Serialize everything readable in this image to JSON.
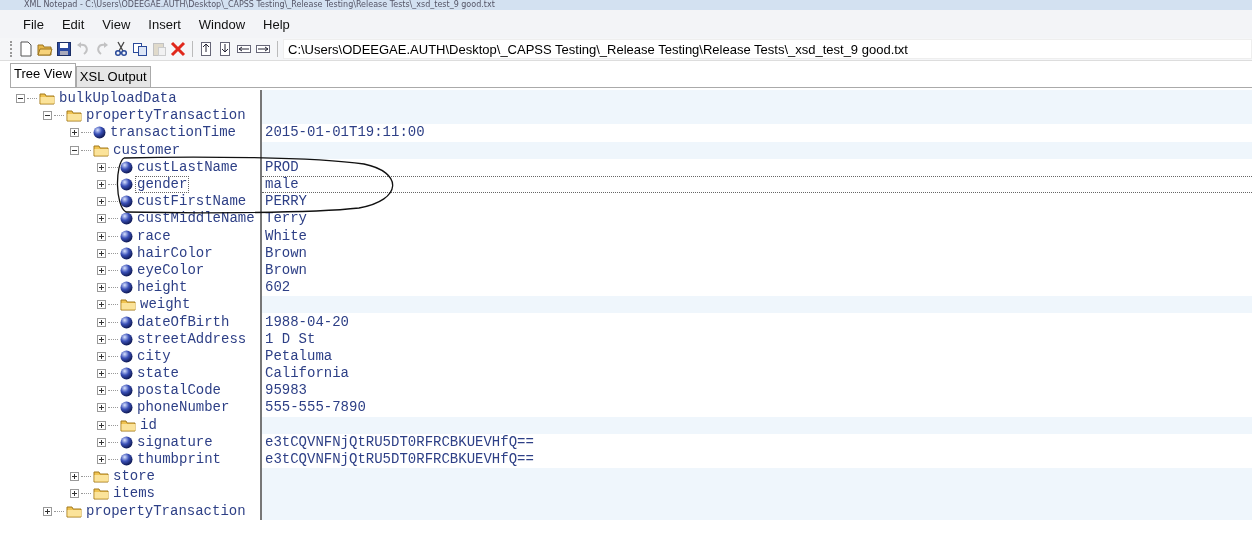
{
  "window": {
    "title": "XML Notepad - C:\\Users\\ODEEGAE.AUTH\\Desktop\\_CAPSS Testing\\_Release Testing\\Release Tests\\_xsd_test_9 good.txt"
  },
  "menu": [
    "File",
    "Edit",
    "View",
    "Insert",
    "Window",
    "Help"
  ],
  "toolbar": {
    "buttons": [
      {
        "kind": "new",
        "disabled": false
      },
      {
        "kind": "open",
        "disabled": false
      },
      {
        "kind": "save",
        "disabled": false
      },
      {
        "kind": "undo",
        "disabled": true
      },
      {
        "kind": "redo",
        "disabled": true
      },
      {
        "kind": "cut",
        "disabled": false
      },
      {
        "kind": "copy",
        "disabled": false
      },
      {
        "kind": "paste",
        "disabled": true
      },
      {
        "kind": "delete",
        "disabled": false
      },
      {
        "kind": "nudge-up",
        "disabled": false
      },
      {
        "kind": "nudge-down",
        "disabled": false
      },
      {
        "kind": "nudge-left",
        "disabled": false
      },
      {
        "kind": "nudge-right",
        "disabled": false
      }
    ],
    "path": "C:\\Users\\ODEEGAE.AUTH\\Desktop\\_CAPSS Testing\\_Release Testing\\Release Tests\\_xsd_test_9 good.txt"
  },
  "tabs": [
    {
      "label": "Tree View",
      "selected": true
    },
    {
      "label": "XSL Output",
      "selected": false
    }
  ],
  "tree": [
    {
      "name": "bulkUploadData",
      "kind": "folder",
      "expanded": true,
      "selected": false,
      "children": [
        {
          "name": "propertyTransaction",
          "kind": "folder",
          "expanded": true,
          "selected": false,
          "children": [
            {
              "name": "transactionTime",
              "kind": "leaf",
              "expanded": false,
              "selected": false,
              "value": "2015-01-01T19:11:00"
            },
            {
              "name": "customer",
              "kind": "folder",
              "expanded": true,
              "selected": false,
              "children": [
                {
                  "name": "custLastName",
                  "kind": "leaf",
                  "expanded": false,
                  "selected": false,
                  "value": "PROD"
                },
                {
                  "name": "gender",
                  "kind": "leaf",
                  "expanded": false,
                  "selected": true,
                  "value": "male"
                },
                {
                  "name": "custFirstName",
                  "kind": "leaf",
                  "expanded": false,
                  "selected": false,
                  "value": "PERRY"
                },
                {
                  "name": "custMiddleName",
                  "kind": "leaf",
                  "expanded": false,
                  "selected": false,
                  "value": "Terry"
                },
                {
                  "name": "race",
                  "kind": "leaf",
                  "expanded": false,
                  "selected": false,
                  "value": "White"
                },
                {
                  "name": "hairColor",
                  "kind": "leaf",
                  "expanded": false,
                  "selected": false,
                  "value": "Brown"
                },
                {
                  "name": "eyeColor",
                  "kind": "leaf",
                  "expanded": false,
                  "selected": false,
                  "value": "Brown"
                },
                {
                  "name": "height",
                  "kind": "leaf",
                  "expanded": false,
                  "selected": false,
                  "value": "602"
                },
                {
                  "name": "weight",
                  "kind": "folder",
                  "expanded": false,
                  "selected": false
                },
                {
                  "name": "dateOfBirth",
                  "kind": "leaf",
                  "expanded": false,
                  "selected": false,
                  "value": "1988-04-20"
                },
                {
                  "name": "streetAddress",
                  "kind": "leaf",
                  "expanded": false,
                  "selected": false,
                  "value": "1 D St"
                },
                {
                  "name": "city",
                  "kind": "leaf",
                  "expanded": false,
                  "selected": false,
                  "value": "Petaluma"
                },
                {
                  "name": "state",
                  "kind": "leaf",
                  "expanded": false,
                  "selected": false,
                  "value": "California"
                },
                {
                  "name": "postalCode",
                  "kind": "leaf",
                  "expanded": false,
                  "selected": false,
                  "value": "95983"
                },
                {
                  "name": "phoneNumber",
                  "kind": "leaf",
                  "expanded": false,
                  "selected": false,
                  "value": "555-555-7890"
                },
                {
                  "name": "id",
                  "kind": "folder",
                  "expanded": false,
                  "selected": false
                },
                {
                  "name": "signature",
                  "kind": "leaf",
                  "expanded": false,
                  "selected": false,
                  "value": "e3tCQVNFNjQtRU5DT0RFRCBKUEVHfQ=="
                },
                {
                  "name": "thumbprint",
                  "kind": "leaf",
                  "expanded": false,
                  "selected": false,
                  "value": "e3tCQVNFNjQtRU5DT0RFRCBKUEVHfQ=="
                }
              ]
            },
            {
              "name": "store",
              "kind": "folder",
              "expanded": false,
              "selected": false
            },
            {
              "name": "items",
              "kind": "folder",
              "expanded": false,
              "selected": false
            }
          ]
        },
        {
          "name": "propertyTransaction",
          "kind": "folder",
          "expanded": false,
          "selected": false
        }
      ]
    }
  ]
}
